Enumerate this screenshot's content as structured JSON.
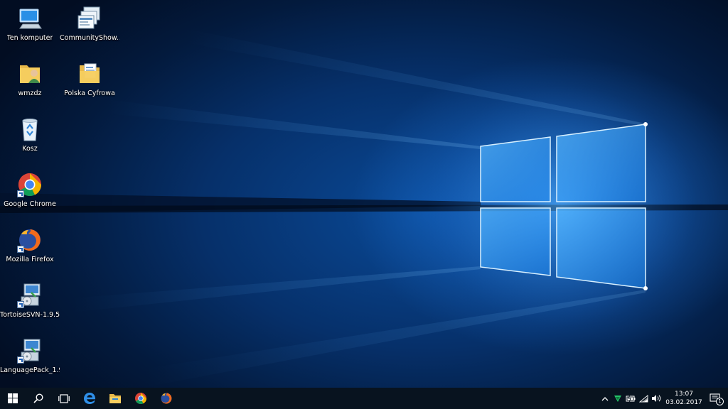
{
  "desktop": {
    "icons": [
      {
        "label": "Ten komputer",
        "icon": "computer-icon"
      },
      {
        "label": "CommunityShow...",
        "icon": "window-stack-icon"
      },
      {
        "label": "wmzdz",
        "icon": "user-folder-icon"
      },
      {
        "label": "Polska Cyfrowa",
        "icon": "folder-documents-icon"
      },
      {
        "label": "Kosz",
        "icon": "recycle-bin-icon"
      },
      {
        "label": "Google Chrome",
        "icon": "chrome-icon"
      },
      {
        "label": "Mozilla Firefox",
        "icon": "firefox-icon"
      },
      {
        "label": "TortoiseSVN-1.9.5....",
        "icon": "installer-icon"
      },
      {
        "label": "LanguagePack_1.9....",
        "icon": "installer-icon"
      }
    ]
  },
  "taskbar": {
    "pinned": [
      "windows-start-icon",
      "search-icon",
      "task-view-icon",
      "edge-icon",
      "file-explorer-icon",
      "chrome-icon",
      "firefox-icon"
    ],
    "tray": [
      "chevron-up-icon",
      "security-shield-icon",
      "battery-icon",
      "wifi-icon",
      "volume-icon"
    ],
    "clock": {
      "time": "13:07",
      "date": "03.02.2017"
    },
    "notifications_count": "1"
  },
  "colors": {
    "taskbar": "#08131f",
    "wallpaper_glow": "#2f8fff",
    "wallpaper_dark": "#020d22"
  }
}
